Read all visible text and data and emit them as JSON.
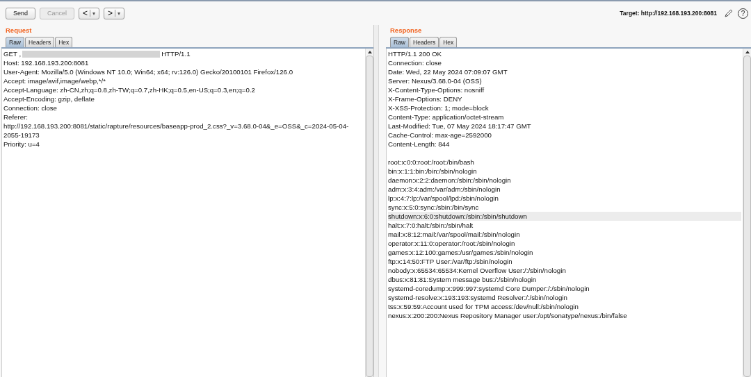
{
  "toolbar": {
    "buttons": [
      {
        "kind": "text",
        "label": "Send",
        "disabled": false
      },
      {
        "kind": "text",
        "label": "Cancel",
        "disabled": true
      },
      {
        "kind": "nav",
        "label": "<",
        "caret": "▾",
        "disabled": false
      },
      {
        "kind": "nav",
        "label": ">",
        "caret": "▾",
        "disabled": false
      }
    ],
    "target": "Target: http://192.168.193.200:8081",
    "help": "?"
  },
  "request": {
    "title": "Request",
    "tabs": [
      {
        "label": "Raw",
        "selected": true
      },
      {
        "label": "Headers",
        "selected": false
      },
      {
        "label": "Hex",
        "selected": false
      }
    ],
    "first_line": {
      "method": "GET ,",
      "version": "HTTP/1.1"
    },
    "lines": [
      "Host: 192.168.193.200:8081",
      "User-Agent: Mozilla/5.0 (Windows NT 10.0; Win64; x64; rv:126.0) Gecko/20100101 Firefox/126.0",
      "Accept: image/avif,image/webp,*/*",
      "Accept-Language: zh-CN,zh;q=0.8,zh-TW;q=0.7,zh-HK;q=0.5,en-US;q=0.3,en;q=0.2",
      "Accept-Encoding: gzip, deflate",
      "Connection: close",
      "Referer:",
      "http://192.168.193.200:8081/static/rapture/resources/baseapp-prod_2.css?_v=3.68.0-04&_e=OSS&_c=2024-05-04-",
      "2055-19173",
      "Priority: u=4"
    ]
  },
  "response": {
    "title": "Response",
    "tabs": [
      {
        "label": "Raw",
        "selected": true
      },
      {
        "label": "Headers",
        "selected": false
      },
      {
        "label": "Hex",
        "selected": false
      }
    ],
    "lines": [
      {
        "text": "HTTP/1.1 200 OK",
        "highlighted": false
      },
      {
        "text": "Connection: close",
        "highlighted": false
      },
      {
        "text": "Date: Wed, 22 May 2024 07:09:07 GMT",
        "highlighted": false
      },
      {
        "text": "Server: Nexus/3.68.0-04 (OSS)",
        "highlighted": false
      },
      {
        "text": "X-Content-Type-Options: nosniff",
        "highlighted": false
      },
      {
        "text": "X-Frame-Options: DENY",
        "highlighted": false
      },
      {
        "text": "X-XSS-Protection: 1; mode=block",
        "highlighted": false
      },
      {
        "text": "Content-Type: application/octet-stream",
        "highlighted": false
      },
      {
        "text": "Last-Modified: Tue, 07 May 2024 18:17:47 GMT",
        "highlighted": false
      },
      {
        "text": "Cache-Control: max-age=2592000",
        "highlighted": false
      },
      {
        "text": "Content-Length: 844",
        "highlighted": false
      }
    ],
    "body": [
      {
        "text": "root:x:0:0:root:/root:/bin/bash",
        "highlighted": false
      },
      {
        "text": "bin:x:1:1:bin:/bin:/sbin/nologin",
        "highlighted": false
      },
      {
        "text": "daemon:x:2:2:daemon:/sbin:/sbin/nologin",
        "highlighted": false
      },
      {
        "text": "adm:x:3:4:adm:/var/adm:/sbin/nologin",
        "highlighted": false
      },
      {
        "text": "lp:x:4:7:lp:/var/spool/lpd:/sbin/nologin",
        "highlighted": false
      },
      {
        "text": "sync:x:5:0:sync:/sbin:/bin/sync",
        "highlighted": false
      },
      {
        "text": "shutdown:x:6:0:shutdown:/sbin:/sbin/shutdown",
        "highlighted": true
      },
      {
        "text": "halt:x:7:0:halt:/sbin:/sbin/halt",
        "highlighted": false
      },
      {
        "text": "mail:x:8:12:mail:/var/spool/mail:/sbin/nologin",
        "highlighted": false
      },
      {
        "text": "operator:x:11:0:operator:/root:/sbin/nologin",
        "highlighted": false
      },
      {
        "text": "games:x:12:100:games:/usr/games:/sbin/nologin",
        "highlighted": false
      },
      {
        "text": "ftp:x:14:50:FTP User:/var/ftp:/sbin/nologin",
        "highlighted": false
      },
      {
        "text": "nobody:x:65534:65534:Kernel Overflow User:/:/sbin/nologin",
        "highlighted": false
      },
      {
        "text": "dbus:x:81:81:System message bus:/:/sbin/nologin",
        "highlighted": false
      },
      {
        "text": "systemd-coredump:x:999:997:systemd Core Dumper:/:/sbin/nologin",
        "highlighted": false
      },
      {
        "text": "systemd-resolve:x:193:193:systemd Resolver:/:/sbin/nologin",
        "highlighted": false
      },
      {
        "text": "tss:x:59:59:Account used for TPM access:/dev/null:/sbin/nologin",
        "highlighted": false
      },
      {
        "text": "nexus:x:200:200:Nexus Repository Manager user:/opt/sonatype/nexus:/bin/false",
        "highlighted": false
      }
    ]
  }
}
